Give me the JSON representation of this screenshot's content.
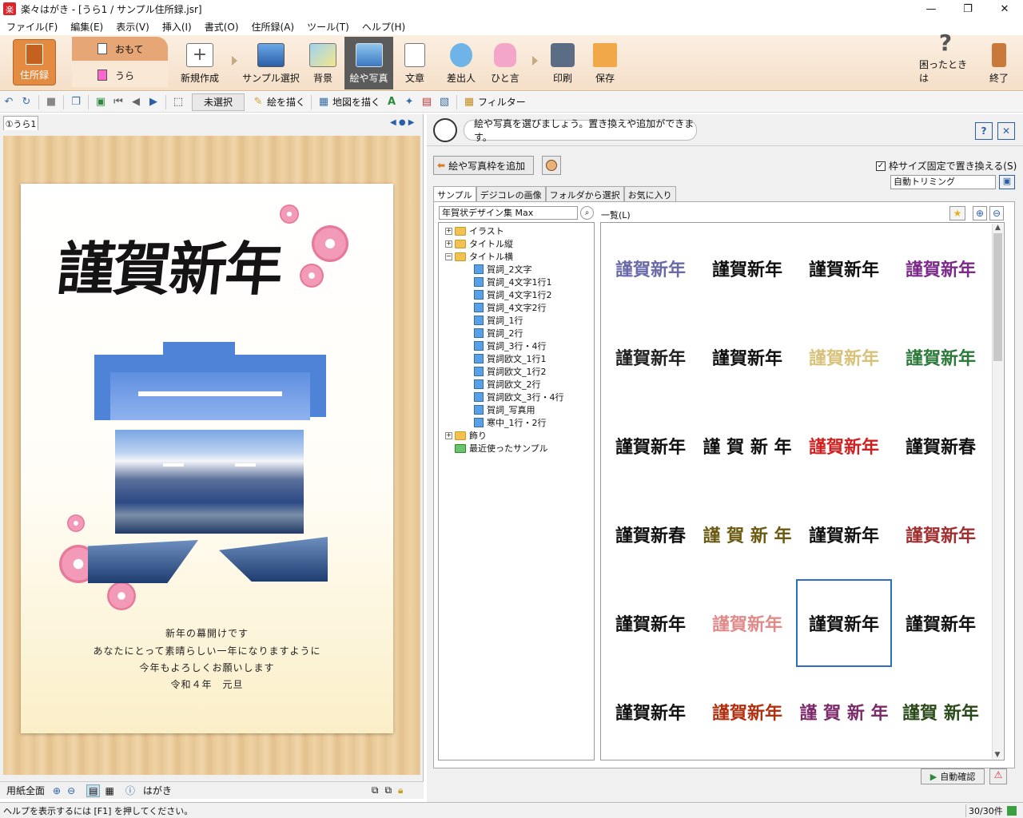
{
  "window": {
    "title": "楽々はがき - [うら1 / サンプル住所録.jsr]",
    "icon_text": "楽"
  },
  "menu": [
    "ファイル(F)",
    "編集(E)",
    "表示(V)",
    "挿入(I)",
    "書式(O)",
    "住所録(A)",
    "ツール(T)",
    "ヘルプ(H)"
  ],
  "ribbon": {
    "address_book": "住所録",
    "side_front": "おもて",
    "side_back": "うら",
    "buttons": [
      "新規作成",
      "サンプル選択",
      "背景",
      "絵や写真",
      "文章",
      "差出人",
      "ひと言",
      "印刷",
      "保存"
    ],
    "help": "困ったときは",
    "exit": "終了"
  },
  "toolbar": {
    "selection": "未選択",
    "draw": "絵を描く",
    "map": "地図を描く",
    "filter": "フィルター"
  },
  "left": {
    "tab": "①うら1",
    "card_title": "謹賀新年",
    "card_lines": [
      "新年の幕開けです",
      "あなたにとって素晴らしい一年になりますように",
      "今年もよろしくお願いします",
      "令和４年　元旦"
    ],
    "status_fit": "用紙全面",
    "status_paper": "はがき"
  },
  "right": {
    "hint": "絵や写真を選びましょう。置き換えや追加ができます。",
    "add_frame": "絵や写真枠を追加",
    "fixed_size": "枠サイズ固定で置き換える(S)",
    "trim": "自動トリミング",
    "tabs": [
      "サンプル",
      "デジコレの画像",
      "フォルダから選択",
      "お気に入り"
    ],
    "collection": "年賀状デザイン集 Max",
    "list_label": "一覧(L)",
    "tree": [
      {
        "label": "イラスト",
        "type": "folder",
        "level": 0,
        "expander": "+"
      },
      {
        "label": "タイトル縦",
        "type": "folder",
        "level": 0,
        "expander": "+"
      },
      {
        "label": "タイトル横",
        "type": "folder",
        "level": 0,
        "expander": "−"
      },
      {
        "label": "賀詞_2文字",
        "type": "leaf",
        "level": 1
      },
      {
        "label": "賀詞_4文字1行1",
        "type": "leaf",
        "level": 1
      },
      {
        "label": "賀詞_4文字1行2",
        "type": "leaf",
        "level": 1
      },
      {
        "label": "賀詞_4文字2行",
        "type": "leaf",
        "level": 1
      },
      {
        "label": "賀詞_1行",
        "type": "leaf",
        "level": 1
      },
      {
        "label": "賀詞_2行",
        "type": "leaf",
        "level": 1
      },
      {
        "label": "賀詞_3行・4行",
        "type": "leaf",
        "level": 1
      },
      {
        "label": "賀詞欧文_1行1",
        "type": "leaf",
        "level": 1
      },
      {
        "label": "賀詞欧文_1行2",
        "type": "leaf",
        "level": 1
      },
      {
        "label": "賀詞欧文_2行",
        "type": "leaf",
        "level": 1
      },
      {
        "label": "賀詞欧文_3行・4行",
        "type": "leaf",
        "level": 1
      },
      {
        "label": "賀詞_写真用",
        "type": "leaf",
        "level": 1
      },
      {
        "label": "寒中_1行・2行",
        "type": "leaf",
        "level": 1
      },
      {
        "label": "飾り",
        "type": "folder",
        "level": 0,
        "expander": "+"
      },
      {
        "label": "最近使ったサンプル",
        "type": "recent",
        "level": 0
      }
    ],
    "grid": [
      {
        "text": "謹賀新年",
        "color": "#6a6aa8"
      },
      {
        "text": "謹賀新年",
        "color": "#111111"
      },
      {
        "text": "謹賀新年",
        "color": "#111111"
      },
      {
        "text": "謹賀新年",
        "color": "#7b2a8a"
      },
      {
        "text": "謹賀新年",
        "color": "#222222"
      },
      {
        "text": "謹賀新年",
        "color": "#111111"
      },
      {
        "text": "謹賀新年",
        "color": "#d8c27a"
      },
      {
        "text": "謹賀新年",
        "color": "#2d7a3a"
      },
      {
        "text": "謹賀新年",
        "color": "#111111"
      },
      {
        "text": "謹 賀 新 年",
        "color": "#111111"
      },
      {
        "text": "謹賀新年",
        "color": "#d02020"
      },
      {
        "text": "謹賀新春",
        "color": "#111111"
      },
      {
        "text": "謹賀新春",
        "color": "#111111"
      },
      {
        "text": "謹 賀 新 年",
        "color": "#6b5a12"
      },
      {
        "text": "謹賀新年",
        "color": "#111111"
      },
      {
        "text": "謹賀新年",
        "color": "#a03030"
      },
      {
        "text": "謹賀新年",
        "color": "#111111"
      },
      {
        "text": "謹賀新年",
        "color": "#e08a8a"
      },
      {
        "text": "謹賀新年",
        "color": "#111111"
      },
      {
        "text": "謹賀新年",
        "color": "#111111"
      },
      {
        "text": "謹賀新年",
        "color": "#111111"
      },
      {
        "text": "謹賀新年",
        "color": "#b03010"
      },
      {
        "text": "謹 賀 新 年",
        "color": "#7b2a6a"
      },
      {
        "text": "謹賀 新年",
        "color": "#2a4a1a"
      }
    ],
    "selected_index": 18,
    "confirm": "自動確認"
  },
  "status": {
    "help": "ヘルプを表示するには [F1] を押してください。",
    "count": "30/30件"
  }
}
